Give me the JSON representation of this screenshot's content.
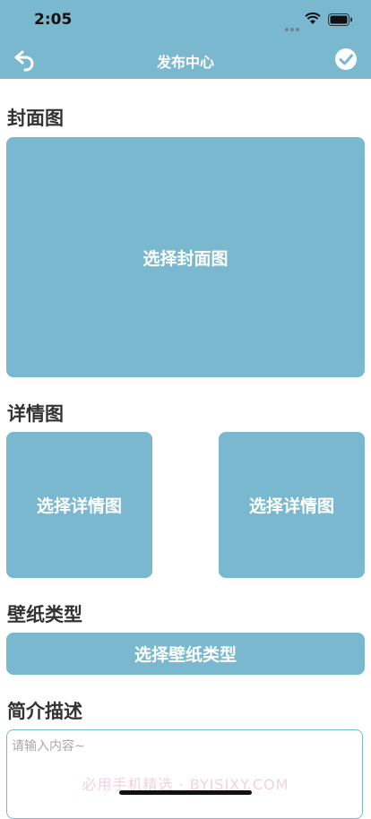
{
  "status": {
    "time": "2:05"
  },
  "header": {
    "title": "发布中心",
    "back_icon": "back-arrow-icon",
    "confirm_icon": "check-circle-icon"
  },
  "cover": {
    "section_title": "封面图",
    "picker_label": "选择封面图"
  },
  "detail": {
    "section_title": "详情图",
    "picker_left_label": "选择详情图",
    "picker_right_label": "选择详情图"
  },
  "wallpaper_type": {
    "section_title": "壁纸类型",
    "picker_label": "选择壁纸类型"
  },
  "description": {
    "section_title": "简介描述",
    "placeholder": "请输入内容~"
  },
  "watermark": "必用手机精选 · BYJSJXY.COM",
  "colors": {
    "accent": "#7ab8d0",
    "title_text": "#333333"
  }
}
